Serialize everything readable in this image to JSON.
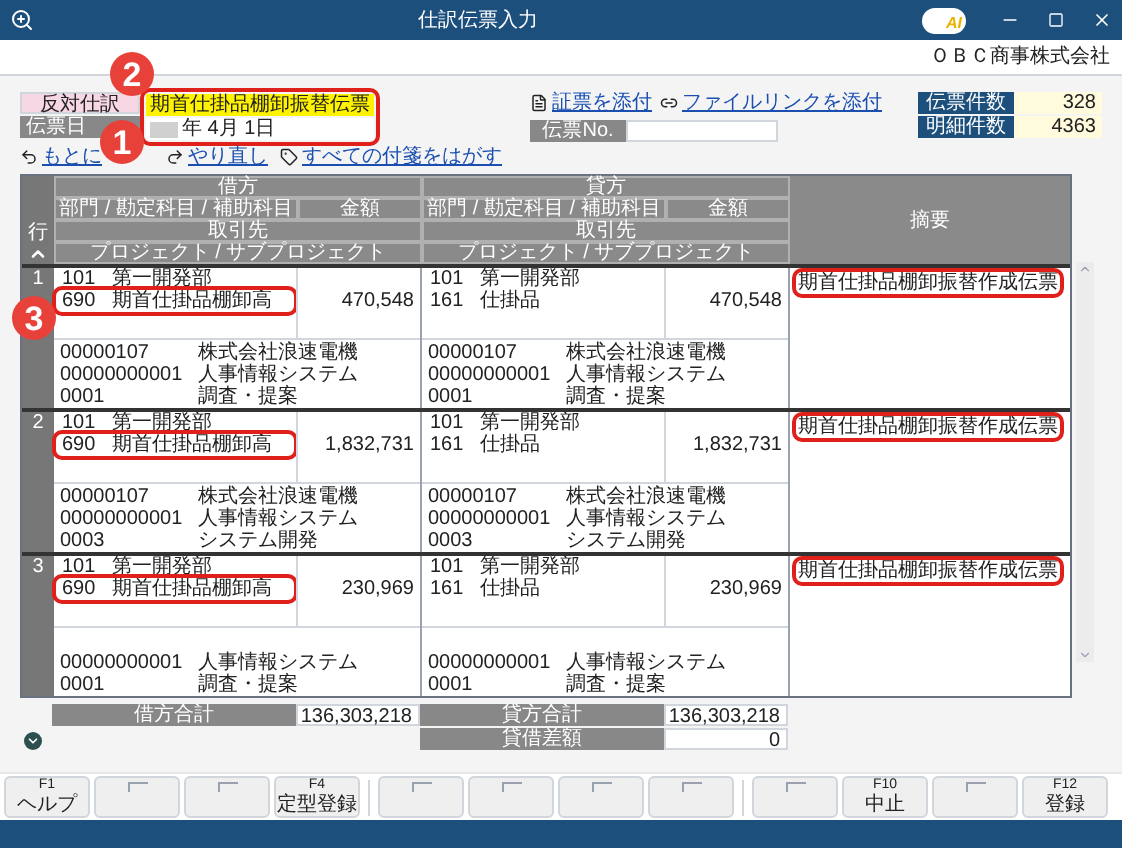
{
  "window": {
    "title": "仕訳伝票入力",
    "logo_text": "AI"
  },
  "company": "ＯＢＣ商事株式会社",
  "header": {
    "reverse_label": "反対仕訳",
    "voucher_type": "期首仕掛品棚卸振替伝票",
    "date_label": "伝票日",
    "date": "年 4月 1日",
    "highlighted": true,
    "attach_links": [
      "証票を添付",
      "ファイルリンクを添付"
    ],
    "voucher_no_label": "伝票No.",
    "counts": [
      {
        "label": "伝票件数",
        "value": "328"
      },
      {
        "label": "明細件数",
        "value": "4363"
      }
    ]
  },
  "actions": [
    {
      "kind": "undo",
      "label": "もとに"
    },
    {
      "kind": "redo",
      "label": "やり直し"
    },
    {
      "kind": "tag",
      "label": "すべての付箋をはがす"
    }
  ],
  "table": {
    "row_header": "行",
    "summary_header": "摘要",
    "sides": [
      {
        "header": "借方",
        "account_header": "部門 / 勘定科目 / 補助科目",
        "amount_header": "金額",
        "partner_header": "取引先",
        "project_header": "プロジェクト / サブプロジェクト"
      },
      {
        "header": "貸方",
        "account_header": "部門 / 勘定科目 / 補助科目",
        "amount_header": "金額",
        "partner_header": "取引先",
        "project_header": "プロジェクト / サブプロジェクト"
      }
    ],
    "rows": [
      {
        "number": "1",
        "highlighted": true,
        "summary": "期首仕掛品棚卸振替作成伝票",
        "debit": {
          "lines": [
            {
              "code": "101",
              "name": "第一開発部"
            },
            {
              "code": "690",
              "name": "期首仕掛品棚卸高"
            }
          ],
          "amount": "470,548",
          "details": [
            {
              "code": "00000107",
              "name": "株式会社浪速電機"
            },
            {
              "code": "00000000001",
              "name": "人事情報システム"
            },
            {
              "code": "0001",
              "name": "調査・提案"
            }
          ]
        },
        "credit": {
          "lines": [
            {
              "code": "101",
              "name": "第一開発部"
            },
            {
              "code": "161",
              "name": "仕掛品"
            }
          ],
          "amount": "470,548",
          "details": [
            {
              "code": "00000107",
              "name": "株式会社浪速電機"
            },
            {
              "code": "00000000001",
              "name": "人事情報システム"
            },
            {
              "code": "0001",
              "name": "調査・提案"
            }
          ]
        }
      },
      {
        "number": "2",
        "highlighted": true,
        "summary": "期首仕掛品棚卸振替作成伝票",
        "debit": {
          "lines": [
            {
              "code": "101",
              "name": "第一開発部"
            },
            {
              "code": "690",
              "name": "期首仕掛品棚卸高"
            }
          ],
          "amount": "1,832,731",
          "details": [
            {
              "code": "00000107",
              "name": "株式会社浪速電機"
            },
            {
              "code": "00000000001",
              "name": "人事情報システム"
            },
            {
              "code": "0003",
              "name": "システム開発"
            }
          ]
        },
        "credit": {
          "lines": [
            {
              "code": "101",
              "name": "第一開発部"
            },
            {
              "code": "161",
              "name": "仕掛品"
            }
          ],
          "amount": "1,832,731",
          "details": [
            {
              "code": "00000107",
              "name": "株式会社浪速電機"
            },
            {
              "code": "00000000001",
              "name": "人事情報システム"
            },
            {
              "code": "0003",
              "name": "システム開発"
            }
          ]
        }
      },
      {
        "number": "3",
        "highlighted": true,
        "summary": "期首仕掛品棚卸振替作成伝票",
        "debit": {
          "lines": [
            {
              "code": "101",
              "name": "第一開発部"
            },
            {
              "code": "690",
              "name": "期首仕掛品棚卸高"
            }
          ],
          "amount": "230,969",
          "details": [
            {
              "code": "00000000001",
              "name": "人事情報システム"
            },
            {
              "code": "0001",
              "name": "調査・提案"
            }
          ]
        },
        "credit": {
          "lines": [
            {
              "code": "101",
              "name": "第一開発部"
            },
            {
              "code": "161",
              "name": "仕掛品"
            }
          ],
          "amount": "230,969",
          "details": [
            {
              "code": "00000000001",
              "name": "人事情報システム"
            },
            {
              "code": "0001",
              "name": "調査・提案"
            }
          ]
        }
      }
    ]
  },
  "totals": {
    "debit": [
      {
        "label": "借方合計",
        "value": "136,303,218"
      }
    ],
    "credit": [
      {
        "label": "貸方合計",
        "value": "136,303,218"
      },
      {
        "label": "貸借差額",
        "value": "0"
      }
    ]
  },
  "function_keys": [
    {
      "kind": "labeled",
      "key": "F1",
      "label": "ヘルプ"
    },
    {
      "kind": "blank"
    },
    {
      "kind": "blank"
    },
    {
      "kind": "labeled",
      "key": "F4",
      "label": "定型登録"
    },
    {
      "kind": "blank"
    },
    {
      "kind": "blank"
    },
    {
      "kind": "blank"
    },
    {
      "kind": "blank"
    },
    {
      "kind": "blank"
    },
    {
      "kind": "labeled",
      "key": "F10",
      "label": "中止"
    },
    {
      "kind": "blank"
    },
    {
      "kind": "labeled",
      "key": "F12",
      "label": "登録"
    }
  ],
  "callouts": [
    {
      "label": "2"
    },
    {
      "label": "1"
    },
    {
      "label": "3"
    }
  ]
}
